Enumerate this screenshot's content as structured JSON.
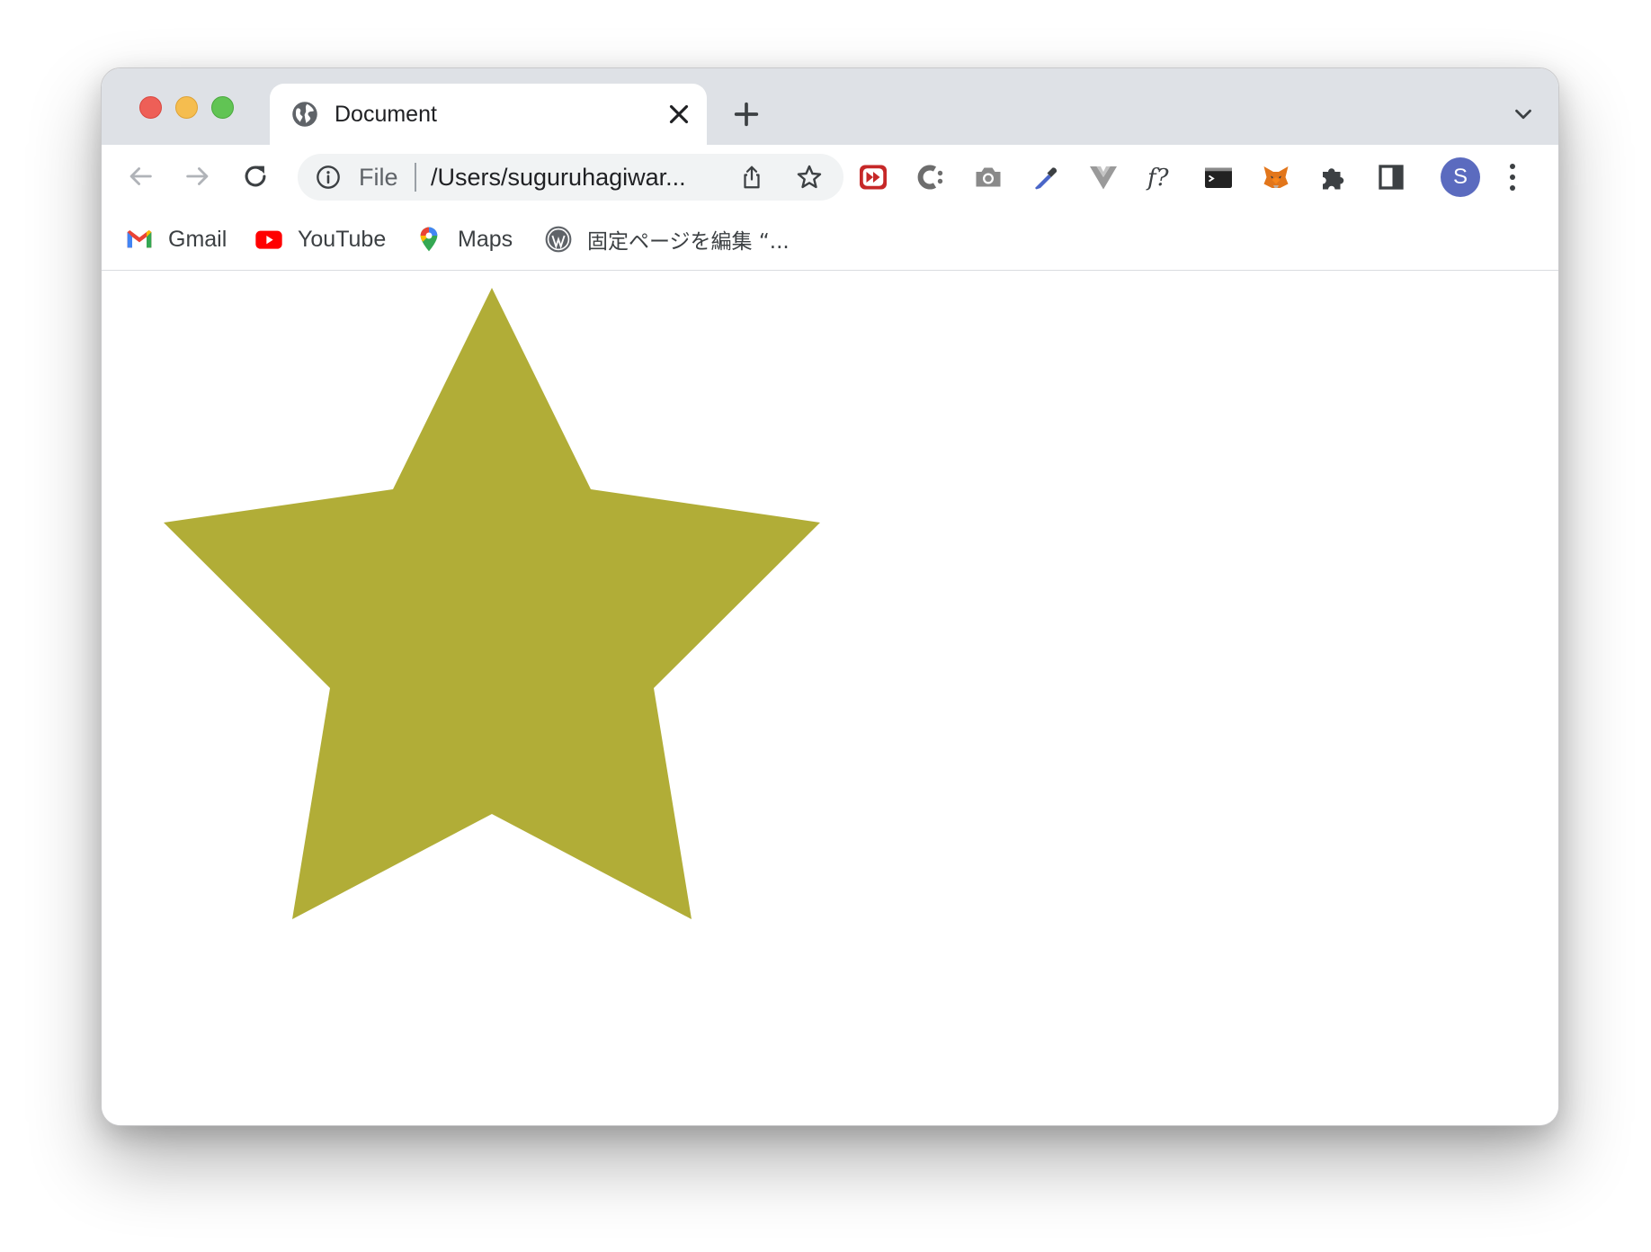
{
  "window": {
    "traffic_lights": [
      "close",
      "minimize",
      "zoom"
    ]
  },
  "tab": {
    "title": "Document",
    "icon": "globe-icon"
  },
  "toolbar": {
    "omnibox": {
      "scheme": "File",
      "url": "/Users/suguruhagiwar..."
    },
    "avatar_initial": "S",
    "extensions": [
      "fast-forward-icon",
      "c-extension-icon",
      "camera-icon",
      "eyedropper-icon",
      "vue-icon",
      "font-finder-icon",
      "terminal-icon",
      "metamask-fox-icon",
      "puzzle-icon",
      "sidepanel-icon"
    ]
  },
  "bookmarks": [
    {
      "label": "Gmail",
      "icon": "gmail-icon"
    },
    {
      "label": "YouTube",
      "icon": "youtube-icon"
    },
    {
      "label": "Maps",
      "icon": "maps-icon"
    },
    {
      "label": "固定ページを編集 “...",
      "icon": "wordpress-icon"
    }
  ],
  "content": {
    "shape": "star",
    "points": 5,
    "fill_color": "#b1ad37"
  }
}
